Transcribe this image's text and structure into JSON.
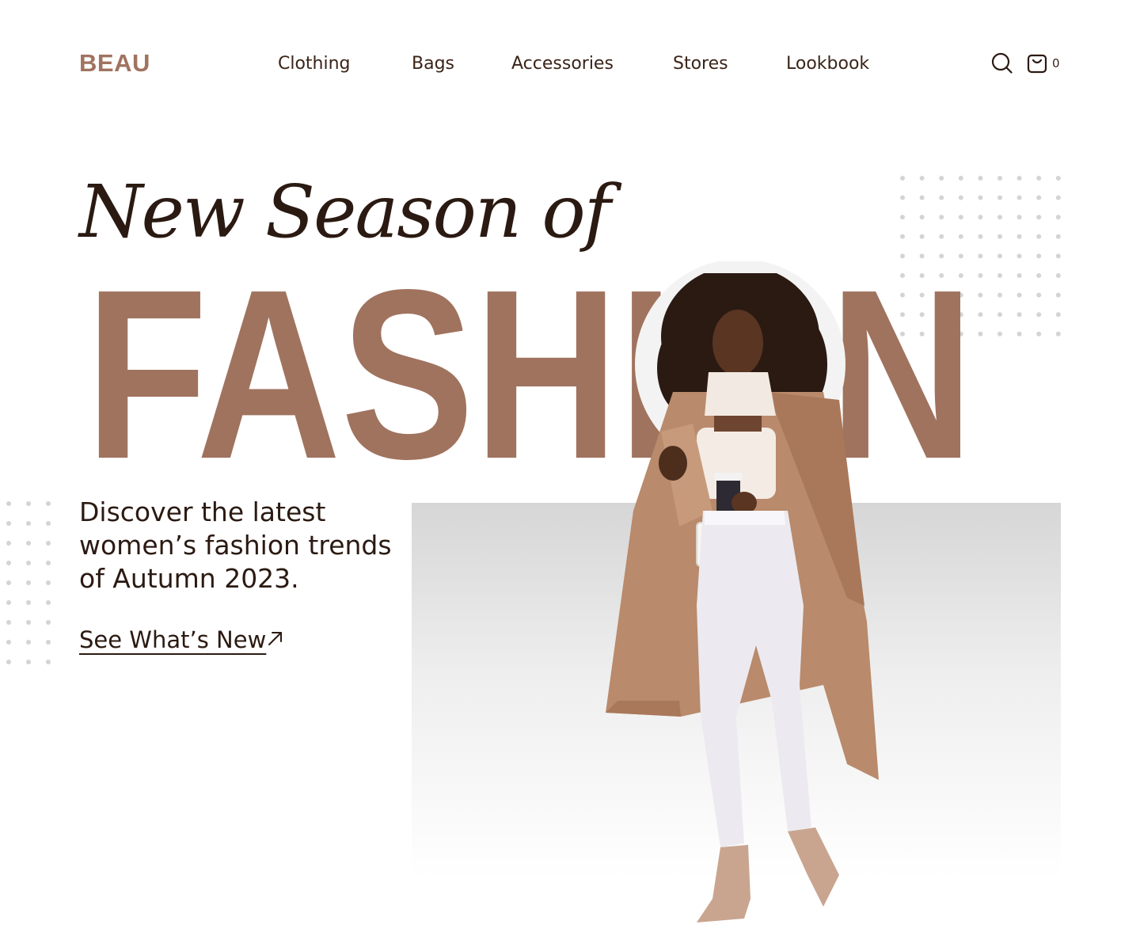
{
  "brand": {
    "name": "BEAU",
    "color": "#a0735f"
  },
  "nav": {
    "items": [
      {
        "label": "Clothing",
        "name": "nav-item-clothing"
      },
      {
        "label": "Bags",
        "name": "nav-item-bags"
      },
      {
        "label": "Accessories",
        "name": "nav-item-accessories"
      },
      {
        "label": "Stores",
        "name": "nav-item-stores"
      },
      {
        "label": "Lookbook",
        "name": "nav-item-lookbook"
      }
    ]
  },
  "header_icons": {
    "search": "search-icon",
    "cart": "shopping-bag-icon",
    "cart_count": "0"
  },
  "hero": {
    "script_headline": "New Season of",
    "big_word": "FASHION",
    "description_lines": [
      "Discover the latest",
      "women’s fashion trends",
      "of Autumn 2023."
    ],
    "cta_label": "See What’s New",
    "cta_icon": "arrow-up-right-icon"
  },
  "colors": {
    "accent": "#a0735f",
    "text": "#2b1a12",
    "dot": "#d4d4d4",
    "photo_bg_top": "#d6d6d6"
  }
}
